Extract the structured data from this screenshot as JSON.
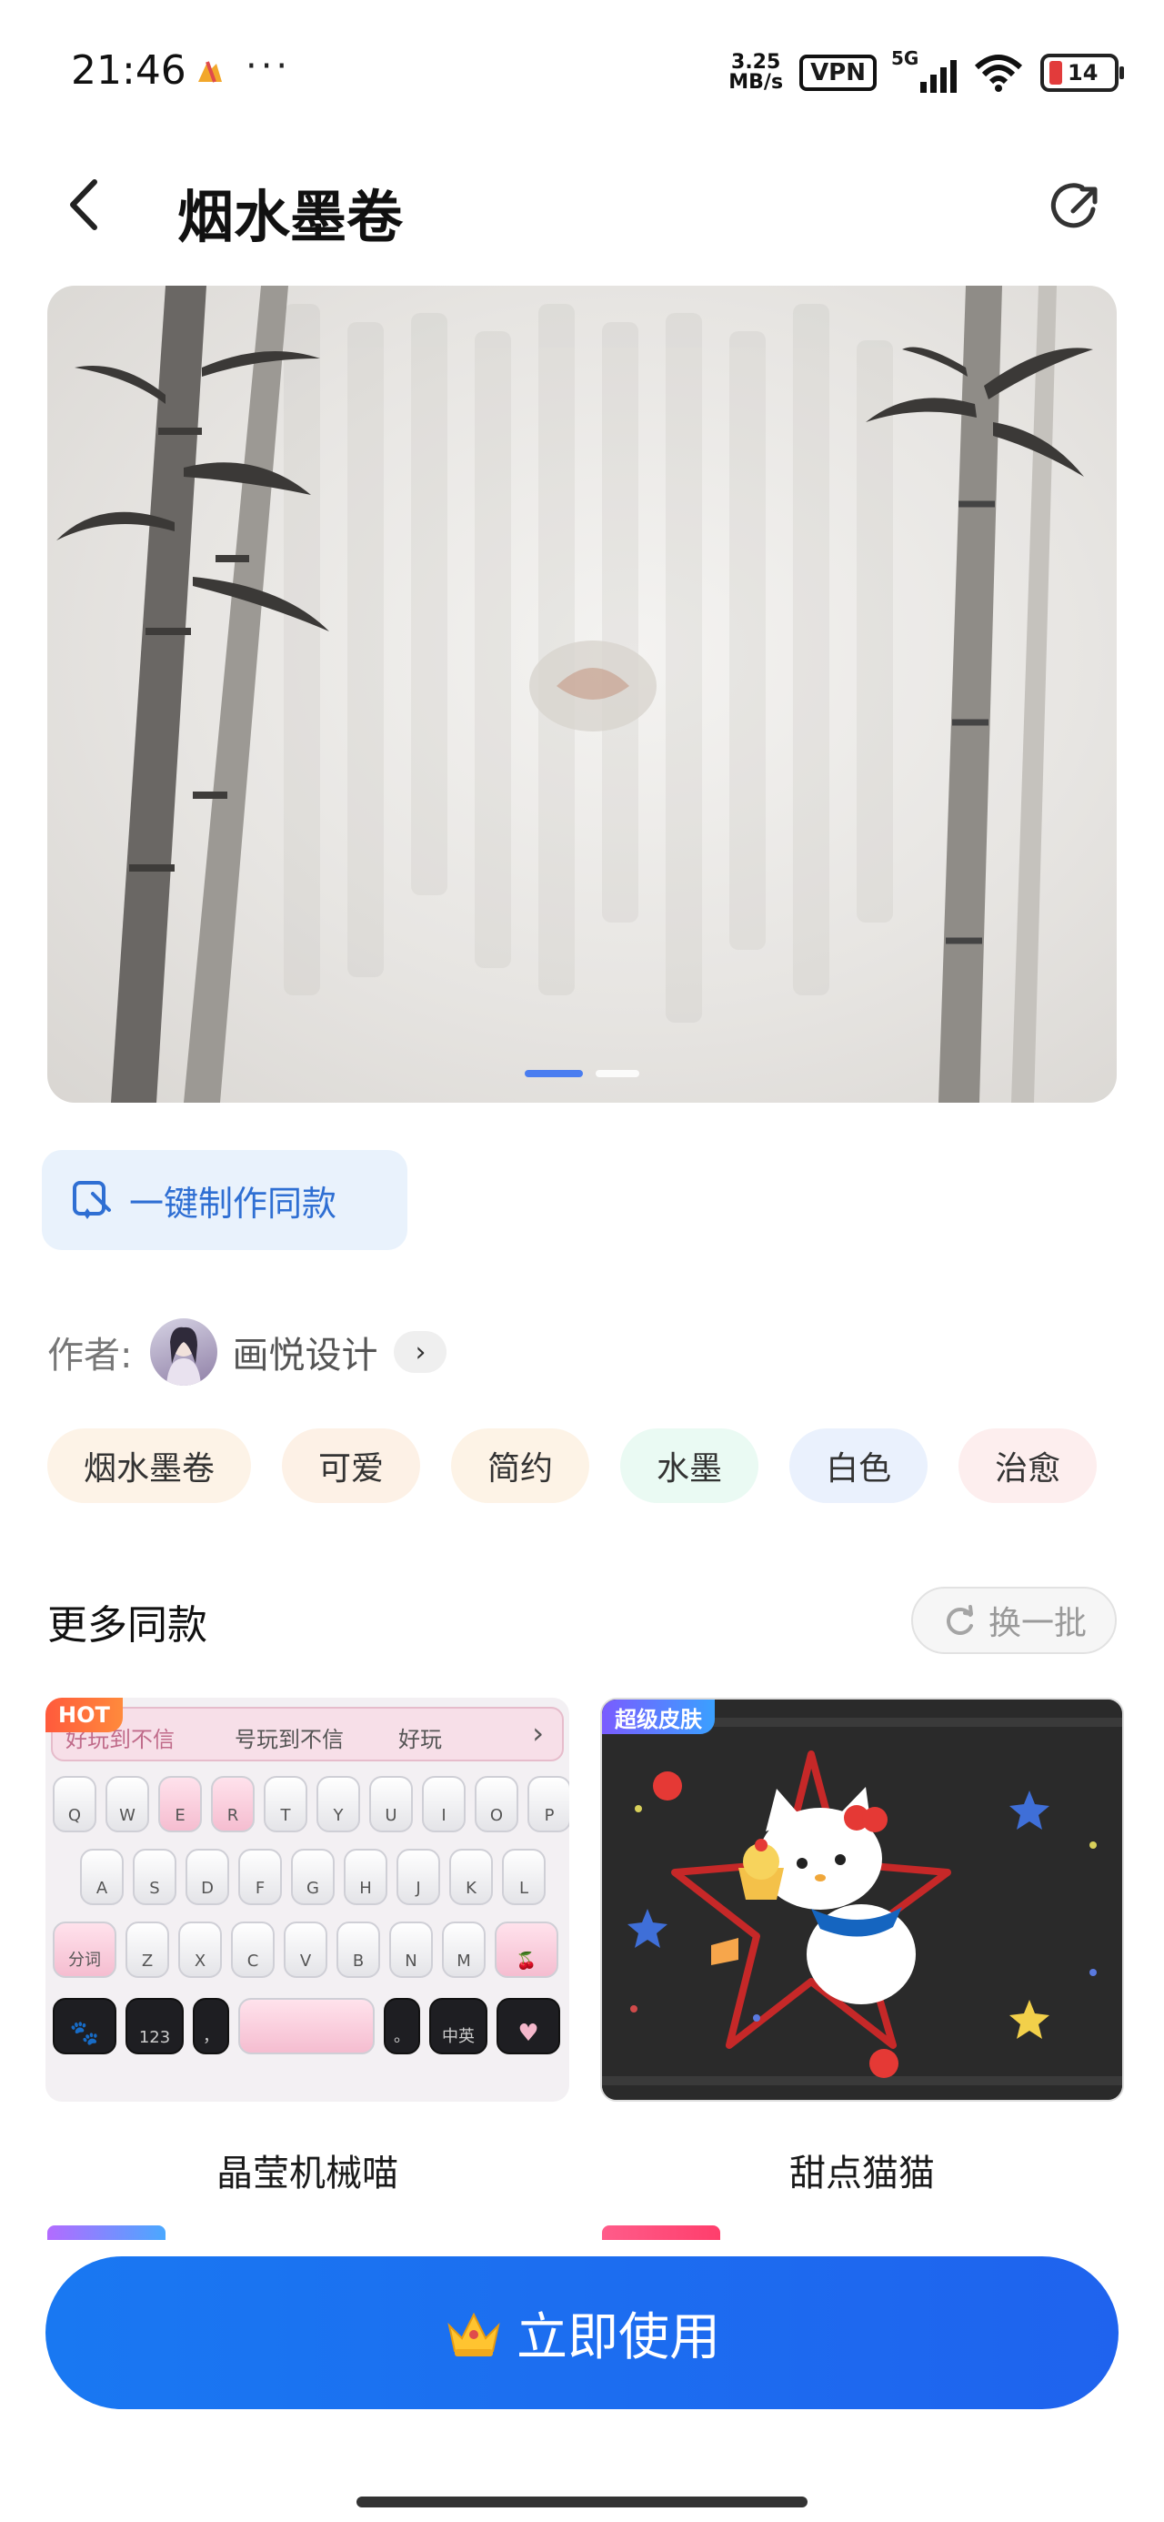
{
  "status": {
    "time": "21:46",
    "more_dots": "···",
    "net_speed_value": "3.25",
    "net_speed_unit": "MB/s",
    "vpn": "VPN",
    "signal_label": "5G",
    "battery": "14",
    "battery_color": "#e23b3b"
  },
  "header": {
    "title": "烟水墨卷"
  },
  "banner": {
    "slide_count": 2,
    "active_slide": 1
  },
  "make_same": {
    "label": "一键制作同款"
  },
  "author": {
    "prefix": "作者:",
    "name": "画悦设计",
    "arrow": "›"
  },
  "tags": [
    {
      "label": "烟水墨卷",
      "bg": "#fdf3e7"
    },
    {
      "label": "可爱",
      "bg": "#fdf1e6"
    },
    {
      "label": "简约",
      "bg": "#fdf3e6"
    },
    {
      "label": "水墨",
      "bg": "#eafaf3"
    },
    {
      "label": "白色",
      "bg": "#eaf1fd"
    },
    {
      "label": "治愈",
      "bg": "#fdeeee"
    }
  ],
  "more": {
    "title": "更多同款",
    "refresh_label": "换一批"
  },
  "cards": [
    {
      "name": "晶莹机械喵",
      "badge": "HOT",
      "keyboard_top": "好玩到不信",
      "keyboard_mid": "号玩到不信",
      "keyboard_hint": "好玩",
      "row1": [
        "Q",
        "W",
        "E",
        "R",
        "T",
        "Y",
        "U",
        "I",
        "O",
        "P"
      ],
      "row2": [
        "A",
        "S",
        "D",
        "F",
        "G",
        "H",
        "J",
        "K",
        "L"
      ],
      "row3": [
        "分词",
        "Z",
        "X",
        "C",
        "V",
        "B",
        "N",
        "M"
      ],
      "bottom": [
        "123",
        "，",
        "。",
        "中英"
      ]
    },
    {
      "name": "甜点猫猫",
      "badge": "超级皮肤"
    }
  ],
  "cta": {
    "label": "立即使用"
  },
  "accent": "#1f6fef"
}
